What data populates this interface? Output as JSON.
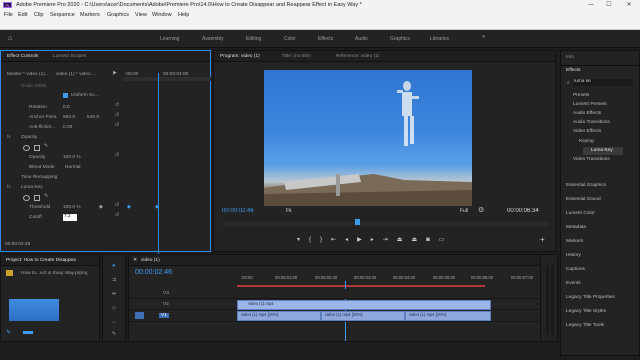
{
  "titlebar": {
    "title": "Adobe Premiere Pro 2020 - C:\\Users\\acer\\Documents\\Adobe\\Premiere Pro\\14.0\\How to Create Disappear and Reappear Effect in Easy Way *",
    "min": "—",
    "max": "☐",
    "close": "✕"
  },
  "menu": [
    "File",
    "Edit",
    "Clip",
    "Sequence",
    "Markers",
    "Graphics",
    "View",
    "Window",
    "Help"
  ],
  "workspaces": [
    "Learning",
    "Assembly",
    "Editing",
    "Color",
    "Effects",
    "Audio",
    "Graphics",
    "Libraries"
  ],
  "effect_controls": {
    "tabs": [
      "Effect Controls",
      "Lumetri Scopes"
    ],
    "source": "Master * video (1)...",
    "clip": "video (1) * video ...",
    "tc_start": ":00:00",
    "tc_end": "00:00:04:00",
    "rows": {
      "scale_width": "Scale Width",
      "uniform_scale": "Uniform Sc...",
      "rotation": "Rotation",
      "rotation_val": "0.0",
      "anchor": "Anchor Point",
      "anchor_x": "960.0",
      "anchor_y": "540.0",
      "anti_flicker": "Anti-flicker...",
      "anti_flicker_val": "0.00",
      "opacity_group": "Opacity",
      "opacity": "Opacity",
      "opacity_val": "100.0 %",
      "blend": "Blend Mode",
      "blend_val": "Normal",
      "time_remap": "Time Remapping",
      "luma_key": "Luma Key",
      "threshold": "Threshold",
      "threshold_val": "100.0 %",
      "cutoff": "Cutoff",
      "cutoff_val": "7.2"
    },
    "timecode": "00:00:02:46"
  },
  "program": {
    "tabs": [
      "Program: video (1)",
      "Title: (no title)",
      "Reference: video (1)"
    ],
    "timecode": "00:00:02:46",
    "fit": "Fit",
    "full": "Full",
    "duration": "00:00:06:34"
  },
  "project": {
    "title": "Project: How to Create Disappea",
    "file": "How to...ect in Easy Way.prproj"
  },
  "timeline": {
    "title": "video (1)",
    "timecode": "00:00:02:46",
    "ruler": [
      ":00:00",
      "00:00:01:00",
      "00:00:02:00",
      "00:00:03:00",
      "00:00:04:00",
      "00:00:05:00",
      "00:00:06:00",
      "00:00:07:00"
    ],
    "tracks": [
      "V3",
      "V2",
      "V1"
    ],
    "clips_v2": [
      "video (1).mp4"
    ],
    "clips_v1": [
      "video (1).mp4 [20%]",
      "video (1).mp4 [20%]",
      "video (1).mp4 [20%]"
    ]
  },
  "effects_panel": {
    "info": "Info",
    "effects": "Effects",
    "search": "luma ke",
    "tree": [
      "Presets",
      "Lumetri Presets",
      "Audio Effects",
      "Audio Transitions",
      "Video Effects",
      "Keying",
      "Luma Key",
      "Video Transitions"
    ],
    "side": [
      "Essential Graphics",
      "Essential Sound",
      "Lumetri Color",
      "Metadata",
      "Markers",
      "History",
      "Captions",
      "Events",
      "Legacy Title Properties",
      "Legacy Title Styles",
      "Legacy Title Tools"
    ]
  }
}
